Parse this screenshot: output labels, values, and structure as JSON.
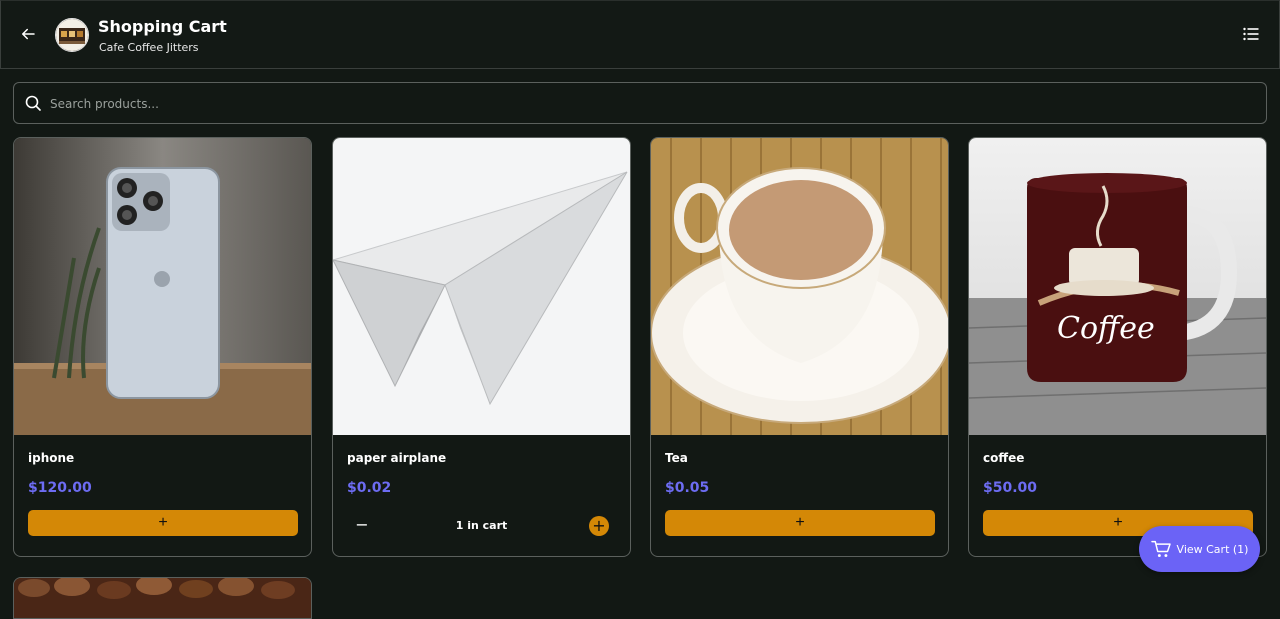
{
  "header": {
    "title": "Shopping Cart",
    "subtitle": "Cafe Coffee Jitters",
    "back_icon": "arrow-left-icon",
    "menu_icon": "list-icon"
  },
  "search": {
    "placeholder": "Search products...",
    "value": ""
  },
  "products": [
    {
      "name": "iphone",
      "price": "$120.00",
      "action": "+",
      "in_cart": 0
    },
    {
      "name": "paper airplane",
      "price": "$0.02",
      "in_cart": 1,
      "cart_text": "1 in cart",
      "minus": "−",
      "plus": "+"
    },
    {
      "name": "Tea",
      "price": "$0.05",
      "action": "+",
      "in_cart": 0
    },
    {
      "name": "coffee",
      "price": "$50.00",
      "action": "+",
      "in_cart": 0
    }
  ],
  "cart_button": {
    "label": "View Cart (1)",
    "icon": "shopping-cart-icon"
  },
  "colors": {
    "background": "#121814",
    "accent": "#d48806",
    "price": "#6d6cf2",
    "cart_button": "#6b63f6"
  }
}
